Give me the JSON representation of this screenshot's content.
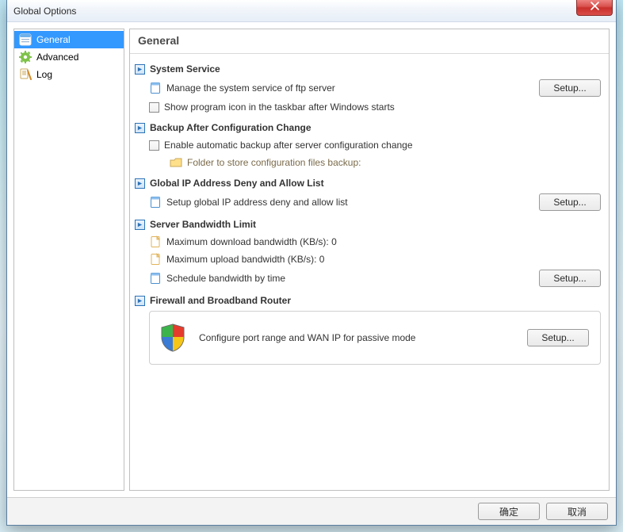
{
  "window": {
    "title": "Global Options"
  },
  "sidebar": {
    "items": [
      {
        "label": "General",
        "selected": true
      },
      {
        "label": "Advanced",
        "selected": false
      },
      {
        "label": "Log",
        "selected": false
      }
    ]
  },
  "header": "General",
  "sections": {
    "system_service": {
      "title": "System Service",
      "manage_label": "Manage the system service of ftp server",
      "tray_label": "Show program icon in the taskbar after Windows starts",
      "setup": "Setup..."
    },
    "backup": {
      "title": "Backup After Configuration Change",
      "enable_label": "Enable automatic backup after server configuration change",
      "folder_label": "Folder to store configuration files backup:"
    },
    "ip_list": {
      "title": "Global IP Address Deny and Allow List",
      "row_label": "Setup global IP address deny and allow list",
      "setup": "Setup..."
    },
    "bandwidth": {
      "title": "Server Bandwidth Limit",
      "download_label": "Maximum download bandwidth (KB/s): 0",
      "upload_label": "Maximum upload bandwidth (KB/s): 0",
      "schedule_label": "Schedule bandwidth by time",
      "setup": "Setup..."
    },
    "router": {
      "title": "Firewall and Broadband Router",
      "row_label": "Configure port range and WAN IP for passive mode",
      "setup": "Setup..."
    }
  },
  "footer": {
    "ok": "确定",
    "cancel": "取消"
  }
}
